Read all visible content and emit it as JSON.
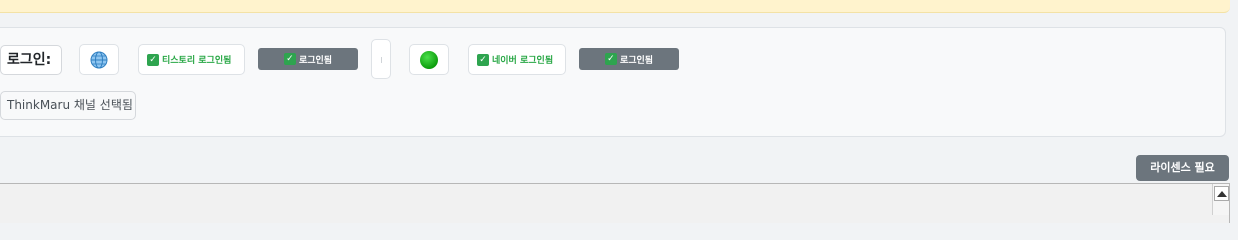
{
  "login_bar": {
    "label": "로그인:",
    "tistory": {
      "status": "티스토리 로그인됨",
      "button": "로그인됨",
      "icon": "globe-icon"
    },
    "naver": {
      "status": "네이버 로그인됨",
      "button": "로그인됨",
      "icon": "green-circle-icon"
    }
  },
  "channel": {
    "label": "ThinkMaru 채널 선택됨"
  },
  "license": {
    "label": "라이센스 필요"
  },
  "colors": {
    "success": "#28a745",
    "muted_button": "#6c757d",
    "notice_bg": "#fff3cd"
  }
}
